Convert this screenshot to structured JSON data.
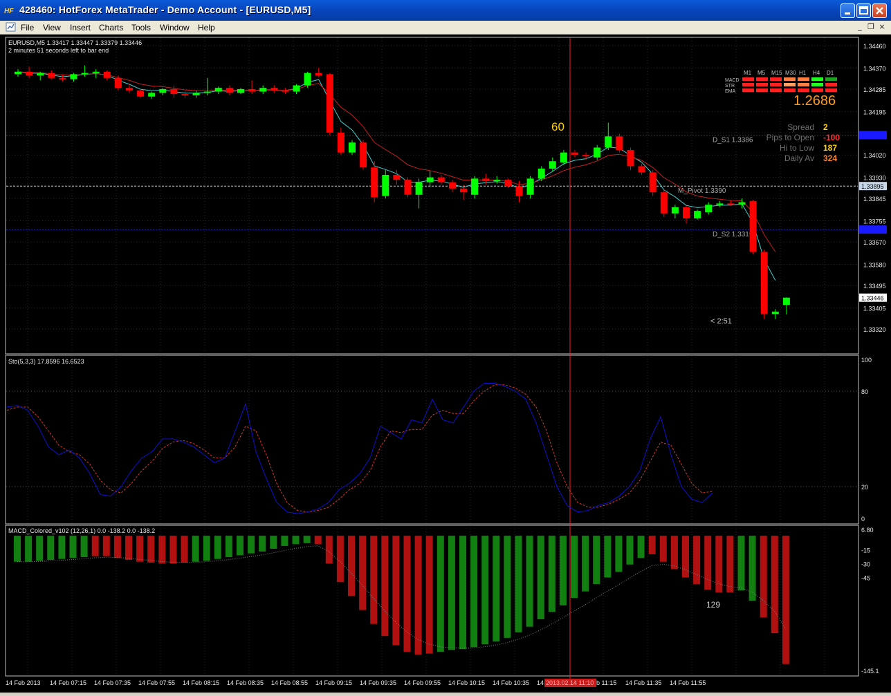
{
  "window": {
    "title": "428460: HotForex MetaTrader - Demo Account - [EURUSD,M5]",
    "app_icon": "metatrader-logo-icon",
    "minimize_icon": "minimize-icon",
    "maximize_icon": "maximize-icon",
    "close_icon": "close-icon"
  },
  "menu": {
    "items": [
      "File",
      "View",
      "Insert",
      "Charts",
      "Tools",
      "Window",
      "Help"
    ],
    "doc_icon": "chart-document-icon",
    "mdi_minimize": "_",
    "mdi_restore": "❐",
    "mdi_close": "×"
  },
  "colors": {
    "background": "#000000",
    "bull": "#00ff00",
    "bear": "#ff0000",
    "ema_fast": "#40d0d0",
    "ema_slow": "#c02020",
    "sto_main": "#1010d0",
    "sto_signal": "#d03a2a",
    "macd_up": "#118011",
    "macd_down": "#b01010",
    "support_line": "#1a1aff",
    "pivot_line": "#d0d0d0",
    "vline": "#ff2020",
    "grid": "#2b2b2b"
  },
  "chart_data": [
    {
      "type": "candlestick",
      "symbol_label": "EURUSD,M5  1.33417 1.33447 1.33379 1.33446",
      "timer_text": "2 minutes 51 seconds left to bar end",
      "ylim": [
        1.3332,
        1.3446
      ],
      "y_ticks": [
        "1.34460",
        "1.34370",
        "1.34285",
        "1.34195",
        "1.34110",
        "1.34020",
        "1.33930",
        "1.33845",
        "1.33755",
        "1.33670",
        "1.33580",
        "1.33495",
        "1.33405",
        "1.33320"
      ],
      "current_price_label": "1.33446",
      "pivot_axis_label": "1.33895",
      "candles": [
        [
          1.34345,
          1.34365,
          1.34335,
          1.34355
        ],
        [
          1.34355,
          1.34375,
          1.3433,
          1.3434
        ],
        [
          1.3434,
          1.34355,
          1.3432,
          1.3435
        ],
        [
          1.3435,
          1.3436,
          1.34325,
          1.3433
        ],
        [
          1.3433,
          1.34345,
          1.34315,
          1.34325
        ],
        [
          1.34325,
          1.3435,
          1.34315,
          1.34345
        ],
        [
          1.34345,
          1.3438,
          1.34335,
          1.3435
        ],
        [
          1.3435,
          1.34365,
          1.3433,
          1.34355
        ],
        [
          1.34355,
          1.3436,
          1.3432,
          1.3433
        ],
        [
          1.3433,
          1.3434,
          1.3428,
          1.3429
        ],
        [
          1.3429,
          1.34305,
          1.3427,
          1.3428
        ],
        [
          1.3428,
          1.34285,
          1.3425,
          1.34255
        ],
        [
          1.34255,
          1.34275,
          1.34245,
          1.3427
        ],
        [
          1.3427,
          1.3429,
          1.3426,
          1.34285
        ],
        [
          1.34285,
          1.343,
          1.3425,
          1.34265
        ],
        [
          1.34265,
          1.34275,
          1.3425,
          1.3426
        ],
        [
          1.3426,
          1.3428,
          1.3425,
          1.3427
        ],
        [
          1.3427,
          1.3433,
          1.3426,
          1.34275
        ],
        [
          1.34275,
          1.34295,
          1.34265,
          1.3429
        ],
        [
          1.3429,
          1.343,
          1.3426,
          1.3427
        ],
        [
          1.3427,
          1.3429,
          1.34265,
          1.34285
        ],
        [
          1.34285,
          1.3432,
          1.34265,
          1.34275
        ],
        [
          1.34275,
          1.343,
          1.34265,
          1.3429
        ],
        [
          1.3429,
          1.343,
          1.3427,
          1.3428
        ],
        [
          1.3428,
          1.3429,
          1.34265,
          1.34275
        ],
        [
          1.34275,
          1.34305,
          1.34265,
          1.343
        ],
        [
          1.343,
          1.34355,
          1.3429,
          1.3435
        ],
        [
          1.3435,
          1.3437,
          1.34335,
          1.3434
        ],
        [
          1.34345,
          1.3435,
          1.341,
          1.3411
        ],
        [
          1.3411,
          1.3413,
          1.3402,
          1.3403
        ],
        [
          1.3403,
          1.3408,
          1.3402,
          1.3407
        ],
        [
          1.3407,
          1.3408,
          1.3396,
          1.3397
        ],
        [
          1.3397,
          1.33995,
          1.3383,
          1.3385
        ],
        [
          1.33855,
          1.3396,
          1.33845,
          1.3394
        ],
        [
          1.3394,
          1.3396,
          1.339,
          1.3392
        ],
        [
          1.3392,
          1.3393,
          1.3385,
          1.3386
        ],
        [
          1.3386,
          1.33925,
          1.33805,
          1.3391
        ],
        [
          1.3391,
          1.33955,
          1.3389,
          1.3393
        ],
        [
          1.3393,
          1.3394,
          1.339,
          1.3391
        ],
        [
          1.3391,
          1.3392,
          1.3387,
          1.33885
        ],
        [
          1.33885,
          1.339,
          1.3384,
          1.3387
        ],
        [
          1.3386,
          1.33935,
          1.33845,
          1.33925
        ],
        [
          1.33925,
          1.33945,
          1.339,
          1.33915
        ],
        [
          1.33915,
          1.33935,
          1.33905,
          1.3392
        ],
        [
          1.3392,
          1.33925,
          1.3389,
          1.33895
        ],
        [
          1.33895,
          1.33915,
          1.3383,
          1.33855
        ],
        [
          1.3386,
          1.33935,
          1.33845,
          1.33925
        ],
        [
          1.33925,
          1.33975,
          1.33915,
          1.33965
        ],
        [
          1.33965,
          1.3401,
          1.33955,
          1.33995
        ],
        [
          1.3399,
          1.3404,
          1.3398,
          1.3403
        ],
        [
          1.3403,
          1.3404,
          1.3401,
          1.3402
        ],
        [
          1.3402,
          1.3403,
          1.34,
          1.34015
        ],
        [
          1.3401,
          1.3406,
          1.34,
          1.3405
        ],
        [
          1.3405,
          1.3415,
          1.3404,
          1.34095
        ],
        [
          1.34095,
          1.34105,
          1.3403,
          1.3404
        ],
        [
          1.3404,
          1.3405,
          1.3396,
          1.33975
        ],
        [
          1.33975,
          1.33985,
          1.3394,
          1.3395
        ],
        [
          1.3395,
          1.3396,
          1.33855,
          1.3387
        ],
        [
          1.3387,
          1.3388,
          1.3377,
          1.33785
        ],
        [
          1.33785,
          1.3382,
          1.33765,
          1.3381
        ],
        [
          1.3381,
          1.33815,
          1.33745,
          1.33765
        ],
        [
          1.33765,
          1.338,
          1.3376,
          1.33795
        ],
        [
          1.3379,
          1.3383,
          1.3378,
          1.3382
        ],
        [
          1.3382,
          1.33835,
          1.3381,
          1.33825
        ],
        [
          1.33825,
          1.3384,
          1.33815,
          1.3382
        ],
        [
          1.3382,
          1.33845,
          1.33805,
          1.3383
        ],
        [
          1.33835,
          1.3384,
          1.3362,
          1.3363
        ],
        [
          1.3363,
          1.3364,
          1.3336,
          1.3338
        ],
        [
          1.3338,
          1.334,
          1.3336,
          1.3339
        ],
        [
          1.33417,
          1.33447,
          1.33379,
          1.33446
        ]
      ],
      "horizontal_levels": [
        {
          "price": 1.341,
          "label": "D_S1 1.3386",
          "kind": "support"
        },
        {
          "price": 1.33895,
          "label": "M_Pivot 1.3390",
          "kind": "pivot"
        },
        {
          "price": 1.3372,
          "label": "D_S2 1.3319",
          "kind": "support"
        }
      ],
      "annotations": {
        "bar_count": "60",
        "countdown": "< 2:51"
      },
      "dashboard": {
        "timeframes": [
          "M1",
          "M5",
          "M15",
          "M30",
          "H1",
          "H4",
          "D1"
        ],
        "rows": [
          "MACD",
          "STR",
          "EMA"
        ],
        "cells": [
          [
            "#ff2020",
            "#ff2020",
            "#ff2020",
            "#ff8040",
            "#ff8040",
            "#20ff20",
            "#20a020"
          ],
          [
            "#ff2020",
            "#ff2020",
            "#ff2020",
            "#ffa060",
            "#ff8040",
            "#20ff20",
            "#ff2020"
          ],
          [
            "#ff2020",
            "#ff2020",
            "#ff2020",
            "#ff2020",
            "#ff2020",
            "#ff2020",
            "#ff2020"
          ]
        ],
        "big_value": "1.2686",
        "stats": [
          {
            "label": "Spread",
            "value": "2",
            "color": "#ffd000"
          },
          {
            "label": "Pips to Open",
            "value": "-100",
            "color": "#ff3030"
          },
          {
            "label": "Hi to Low",
            "value": "187",
            "color": "#ffd000"
          },
          {
            "label": "Daily Av",
            "value": "324",
            "color": "#ff8020"
          }
        ]
      }
    },
    {
      "type": "line",
      "title": "Sto(5,3,3) 17.8596 16.6523",
      "ylim": [
        0,
        100
      ],
      "y_ticks": [
        "100",
        "80",
        "20",
        "0"
      ],
      "series": [
        {
          "values": [
            70,
            71,
            68,
            58,
            45,
            40,
            43,
            38,
            28,
            15,
            14,
            20,
            30,
            38,
            42,
            50,
            50,
            48,
            45,
            40,
            35,
            38,
            55,
            72,
            42,
            25,
            10,
            4,
            3,
            4,
            6,
            10,
            18,
            22,
            28,
            38,
            58,
            54,
            50,
            62,
            60,
            75,
            62,
            60,
            70,
            80,
            85,
            85,
            83,
            80,
            75,
            60,
            40,
            20,
            8,
            4,
            5,
            8,
            10,
            14,
            20,
            30,
            50,
            64,
            40,
            20,
            12,
            10,
            16
          ]
        },
        {
          "values": [
            68,
            70,
            70,
            64,
            55,
            46,
            42,
            40,
            34,
            24,
            18,
            16,
            22,
            30,
            36,
            44,
            48,
            49,
            47,
            43,
            38,
            38,
            45,
            58,
            55,
            40,
            22,
            10,
            5,
            4,
            5,
            7,
            12,
            18,
            22,
            30,
            45,
            55,
            54,
            56,
            56,
            65,
            68,
            66,
            66,
            74,
            80,
            84,
            84,
            82,
            78,
            70,
            55,
            35,
            20,
            10,
            7,
            7,
            9,
            12,
            16,
            24,
            36,
            48,
            46,
            34,
            22,
            16,
            17
          ]
        }
      ]
    },
    {
      "type": "bar",
      "title": "MACD_Colored_v102 (12,26,1) 0.0 -138.2 0.0 -138.2",
      "ylim": [
        -145.1,
        6.8
      ],
      "y_ticks": [
        "6.80",
        "-15",
        "-30",
        "-45",
        "-145.1"
      ],
      "values": [
        -28,
        -28,
        -27,
        -26,
        -25,
        -24,
        -23,
        -22,
        -22,
        -24,
        -26,
        -28,
        -29,
        -30,
        -30,
        -29,
        -28,
        -27,
        -25,
        -23,
        -21,
        -19,
        -17,
        -14,
        -11,
        -9,
        -8,
        -9,
        -30,
        -50,
        -65,
        -80,
        -95,
        -108,
        -118,
        -125,
        -128,
        -127,
        -125,
        -123,
        -122,
        -120,
        -117,
        -114,
        -110,
        -104,
        -98,
        -90,
        -82,
        -75,
        -67,
        -60,
        -52,
        -45,
        -39,
        -31,
        -24,
        -20,
        -28,
        -36,
        -45,
        -52,
        -58,
        -61,
        -61,
        -59,
        -70,
        -88,
        -105,
        -138.2
      ],
      "colors": [
        "u",
        "u",
        "u",
        "u",
        "u",
        "u",
        "u",
        "d",
        "d",
        "d",
        "d",
        "d",
        "d",
        "d",
        "d",
        "d",
        "u",
        "u",
        "u",
        "u",
        "u",
        "u",
        "u",
        "u",
        "u",
        "u",
        "u",
        "d",
        "d",
        "d",
        "d",
        "d",
        "d",
        "d",
        "d",
        "d",
        "d",
        "d",
        "u",
        "u",
        "u",
        "u",
        "u",
        "u",
        "u",
        "u",
        "u",
        "u",
        "u",
        "u",
        "u",
        "u",
        "u",
        "u",
        "u",
        "u",
        "u",
        "d",
        "d",
        "d",
        "d",
        "d",
        "d",
        "d",
        "d",
        "u",
        "u",
        "d",
        "d",
        "d"
      ],
      "value_label": "129"
    }
  ],
  "time_axis": {
    "labels": [
      "14 Feb 2013",
      "14 Feb 07:15",
      "14 Feb 07:35",
      "14 Feb 07:55",
      "14 Feb 08:15",
      "14 Feb 08:35",
      "14 Feb 08:55",
      "14 Feb 09:15",
      "14 Feb 09:35",
      "14 Feb 09:55",
      "14 Feb 10:15",
      "14 Feb 10:35",
      "14",
      "b 11:15",
      "14 Feb 11:35",
      "14 Feb 11:55"
    ],
    "crosshair_label": "2013.02.14 11:10"
  }
}
